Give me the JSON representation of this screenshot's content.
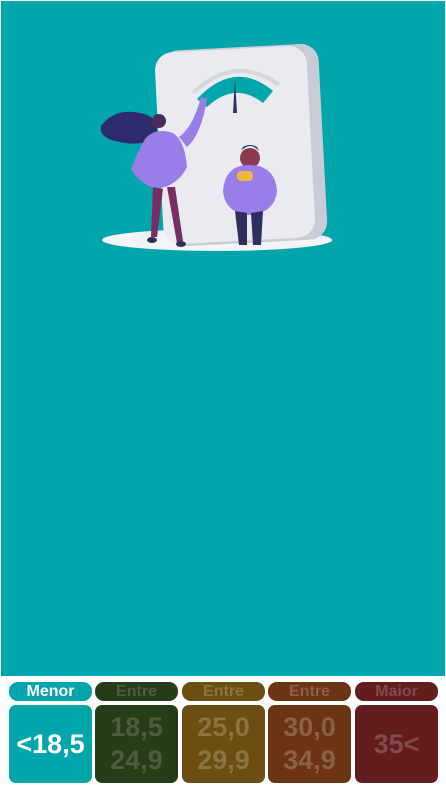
{
  "colors": {
    "background": "#00a6ac",
    "underweight": "#00a6ac",
    "normal": "#243e1a",
    "overweight": "#6b4e10",
    "obese": "#6b3412",
    "severe": "#641d1d"
  },
  "illustration": {
    "icon": "weighing-scale-illustration"
  },
  "bmi_ranges": [
    {
      "label": "Menor",
      "line1": "<18,5",
      "line2": "",
      "active": true
    },
    {
      "label": "Entre",
      "line1": "18,5",
      "line2": "24,9",
      "active": false
    },
    {
      "label": "Entre",
      "line1": "25,0",
      "line2": "29,9",
      "active": false
    },
    {
      "label": "Entre",
      "line1": "30,0",
      "line2": "34,9",
      "active": false
    },
    {
      "label": "Maior",
      "line1": "35<",
      "line2": "",
      "active": false
    }
  ]
}
